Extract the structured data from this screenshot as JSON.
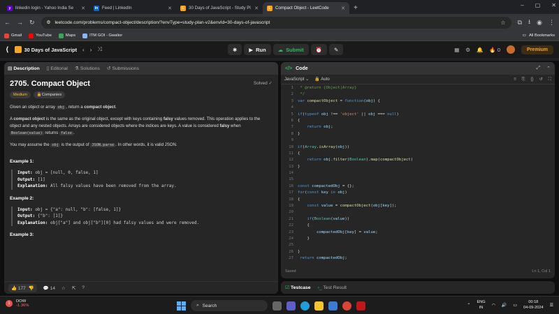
{
  "browser": {
    "tabs": [
      {
        "title": "linkedin login - Yahoo India Se",
        "color": "#6001d2",
        "icon": "yahoo-icon",
        "letter": "y"
      },
      {
        "title": "Feed | LinkedIn",
        "color": "#0a66c2",
        "icon": "linkedin-icon",
        "letter": "in"
      },
      {
        "title": "30 Days of JavaScript - Study Pl",
        "color": "#ffa116",
        "icon": "leetcode-icon",
        "letter": "L"
      },
      {
        "title": "Compact Object - LeetCode",
        "color": "#ffa116",
        "icon": "leetcode-icon",
        "letter": "L"
      }
    ],
    "url": "leetcode.com/problems/compact-object/description/?envType=study-plan-v2&envId=30-days-of-javascript",
    "bookmarks": [
      {
        "label": "Gmail",
        "color": "#ea4335"
      },
      {
        "label": "YouTube",
        "color": "#ff0000"
      },
      {
        "label": "Maps",
        "color": "#34a853"
      },
      {
        "label": "ITM GOI - Gwalior",
        "color": "#8ab4f8"
      }
    ],
    "all_bookmarks": "All Bookmarks"
  },
  "leetcode_nav": {
    "study_plan": "30 Days of JavaScript",
    "run": "Run",
    "submit": "Submit",
    "streak": "0",
    "premium": "Premium"
  },
  "problem": {
    "tabs": [
      "Description",
      "Editorial",
      "Solutions",
      "Submissions"
    ],
    "title": "2705. Compact Object",
    "solved": "Solved",
    "difficulty": "Medium",
    "companies": "Companies",
    "p1_a": "Given an object or array ",
    "p1_code": "obj",
    "p1_b": ", return a ",
    "p1_bold": "compact object",
    "p1_c": ".",
    "p2_a": "A ",
    "p2_bold1": "compact object",
    "p2_b": " is the same as the original object, except with keys containing ",
    "p2_bold2": "falsy",
    "p2_c": " values removed. This operation applies to the object and any nested objects. Arrays are considered objects where the indices are keys. A value is considered ",
    "p2_bold3": "falsy",
    "p2_d": " when ",
    "p2_code1": "Boolean(value)",
    "p2_e": " returns ",
    "p2_code2": "false",
    "p2_f": ".",
    "p3_a": "You may assume the ",
    "p3_code1": "obj",
    "p3_b": " is the output of ",
    "p3_code2": "JSON.parse",
    "p3_c": ". In other words, it is valid JSON.",
    "input_label": "Input:",
    "output_label": "Output:",
    "explanation_label": "Explanation:",
    "examples": [
      {
        "title": "Example 1:",
        "input": "obj = [null, 0, false, 1]",
        "output": "[1]",
        "explanation": "All falsy values have been removed from the array."
      },
      {
        "title": "Example 2:",
        "input": "obj = {\"a\": null, \"b\": [false, 1]}",
        "output": "{\"b\": [1]}",
        "explanation": "obj[\"a\"] and obj[\"b\"][0] had falsy values and were removed."
      },
      {
        "title": "Example 3:"
      }
    ],
    "likes": "177",
    "comments": "14"
  },
  "editor": {
    "title": "Code",
    "language": "JavaScript",
    "mode": "Auto",
    "status_left": "Saved",
    "status_right": "Ln 1, Col 1",
    "lines": [
      {
        "n": "1",
        "t": " * @return {Object|Array}"
      },
      {
        "n": "2",
        "t": " */"
      },
      {
        "n": "3",
        "t": "var compactObject = function(obj) {"
      },
      {
        "n": "4",
        "t": ""
      },
      {
        "n": "5",
        "t": "if(typeof obj !== 'object' || obj === null)"
      },
      {
        "n": "6",
        "t": "{"
      },
      {
        "n": "7",
        "t": "    return obj;"
      },
      {
        "n": "8",
        "t": "}"
      },
      {
        "n": "9",
        "t": ""
      },
      {
        "n": "10",
        "t": "if(Array.isArray(obj))"
      },
      {
        "n": "11",
        "t": "{"
      },
      {
        "n": "12",
        "t": "    return obj.filter(Boolean).map(compactObject)"
      },
      {
        "n": "13",
        "t": "}"
      },
      {
        "n": "14",
        "t": ""
      },
      {
        "n": "15",
        "t": ""
      },
      {
        "n": "16",
        "t": "const compactedObj = {};"
      },
      {
        "n": "17",
        "t": "for(const key in obj)"
      },
      {
        "n": "18",
        "t": "{"
      },
      {
        "n": "19",
        "t": "    const value = compactObject(obj[key]);"
      },
      {
        "n": "20",
        "t": ""
      },
      {
        "n": "21",
        "t": "    if(Boolean(value))"
      },
      {
        "n": "22",
        "t": "    {"
      },
      {
        "n": "23",
        "t": "        compactedObj[key] = value;"
      },
      {
        "n": "24",
        "t": "    }"
      },
      {
        "n": "25",
        "t": ""
      },
      {
        "n": "26",
        "t": "}"
      },
      {
        "n": "27",
        "t": " return compactedObj;"
      }
    ]
  },
  "testpanel": {
    "testcase": "Testcase",
    "result": "Test Result"
  },
  "taskbar": {
    "weather_label": "DOW",
    "weather_change": "-1.36%",
    "weather_badge": "1",
    "search": "Search",
    "lang1": "ENG",
    "lang2": "IN",
    "time": "00:18",
    "date": "04-09-2024"
  }
}
